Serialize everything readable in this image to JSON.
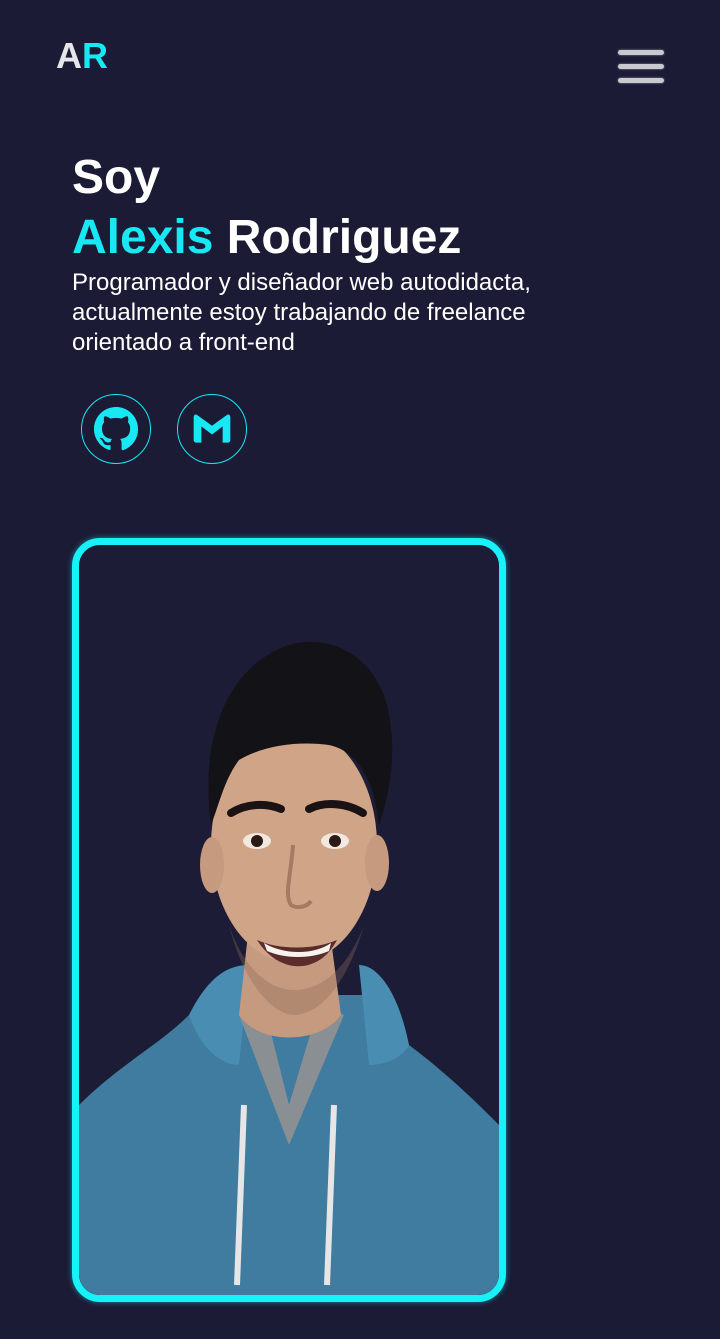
{
  "header": {
    "logo_first": "A",
    "logo_second": "R",
    "menu_icon": "hamburger-menu-icon"
  },
  "hero": {
    "intro": "Soy",
    "first_name": "Alexis",
    "last_name": "Rodriguez",
    "description": "Programador y diseñador web autodidacta, actualmente estoy trabajando de freelance orientado a front-end"
  },
  "social": [
    {
      "icon": "github-icon"
    },
    {
      "icon": "gmail-icon"
    }
  ],
  "profile_photo": {
    "icon": "profile-photo"
  },
  "colors": {
    "background": "#1b1b35",
    "accent": "#17e8f3",
    "text": "#ffffff"
  }
}
